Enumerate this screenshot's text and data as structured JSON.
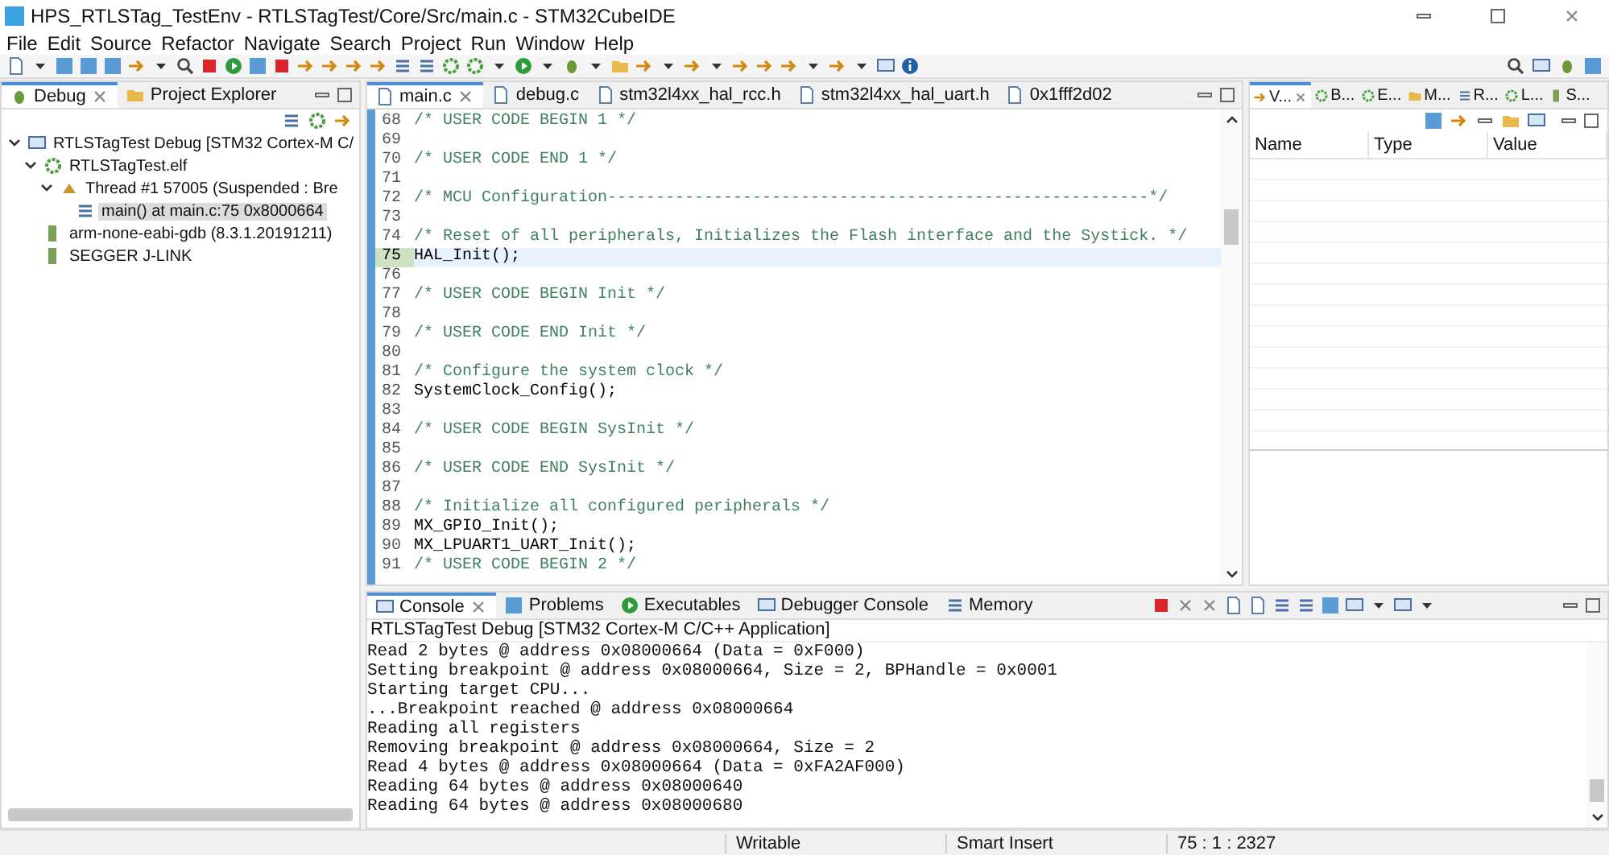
{
  "window": {
    "title": "HPS_RTLSTag_TestEnv - RTLSTagTest/Core/Src/main.c - STM32CubeIDE"
  },
  "menu": [
    "File",
    "Edit",
    "Source",
    "Refactor",
    "Navigate",
    "Search",
    "Project",
    "Run",
    "Window",
    "Help"
  ],
  "debug_panel": {
    "tabs": [
      {
        "label": "Debug",
        "selected": true
      },
      {
        "label": "Project Explorer",
        "selected": false
      }
    ],
    "tree": [
      {
        "label": "RTLSTagTest Debug [STM32 Cortex-M C/",
        "kind": "launch",
        "expanded": true,
        "selected": false,
        "children": [
          {
            "label": "RTLSTagTest.elf",
            "kind": "elf",
            "expanded": true,
            "selected": false,
            "children": [
              {
                "label": "Thread #1 57005 (Suspended : Bre",
                "kind": "thread",
                "expanded": true,
                "selected": false,
                "children": [
                  {
                    "label": "main() at main.c:75 0x8000664",
                    "kind": "frame",
                    "selected": true
                  }
                ]
              }
            ]
          },
          {
            "label": "arm-none-eabi-gdb (8.3.1.20191211)",
            "kind": "process",
            "selected": false
          },
          {
            "label": "SEGGER J-LINK",
            "kind": "process",
            "selected": false
          }
        ]
      }
    ]
  },
  "editor": {
    "tabs": [
      {
        "label": "main.c",
        "selected": true
      },
      {
        "label": "debug.c",
        "selected": false
      },
      {
        "label": "stm32l4xx_hal_rcc.h",
        "selected": false
      },
      {
        "label": "stm32l4xx_hal_uart.h",
        "selected": false
      },
      {
        "label": "0x1fff2d02",
        "selected": false
      }
    ],
    "lines": [
      {
        "number": "68",
        "text": "/* USER CODE BEGIN 1 */",
        "kind": "comment",
        "current": false
      },
      {
        "number": "69",
        "current": false
      },
      {
        "number": "70",
        "text": "/* USER CODE END 1 */",
        "kind": "comment",
        "current": false
      },
      {
        "number": "71",
        "current": false
      },
      {
        "number": "72",
        "text": "/* MCU Configuration--------------------------------------------------------*/",
        "kind": "comment",
        "current": false
      },
      {
        "number": "73",
        "current": false
      },
      {
        "number": "74",
        "text": "/* Reset of all peripherals, Initializes the Flash interface and the Systick. */",
        "kind": "comment",
        "current": false
      },
      {
        "number": "75",
        "text": "HAL_Init();",
        "kind": "code",
        "current": true
      },
      {
        "number": "76",
        "current": false
      },
      {
        "number": "77",
        "text": "/* USER CODE BEGIN Init */",
        "kind": "comment",
        "current": false
      },
      {
        "number": "78",
        "current": false
      },
      {
        "number": "79",
        "text": "/* USER CODE END Init */",
        "kind": "comment",
        "current": false
      },
      {
        "number": "80",
        "current": false
      },
      {
        "number": "81",
        "text": "/* Configure the system clock */",
        "kind": "comment",
        "current": false
      },
      {
        "number": "82",
        "text": "SystemClock_Config();",
        "kind": "code",
        "current": false
      },
      {
        "number": "83",
        "current": false
      },
      {
        "number": "84",
        "text": "/* USER CODE BEGIN SysInit */",
        "kind": "comment",
        "current": false
      },
      {
        "number": "85",
        "current": false
      },
      {
        "number": "86",
        "text": "/* USER CODE END SysInit */",
        "kind": "comment",
        "current": false
      },
      {
        "number": "87",
        "current": false
      },
      {
        "number": "88",
        "text": "/* Initialize all configured peripherals */",
        "kind": "comment",
        "current": false
      },
      {
        "number": "89",
        "text": "MX_GPIO_Init();",
        "kind": "code",
        "current": false
      },
      {
        "number": "90",
        "text": "MX_LPUART1_UART_Init();",
        "kind": "code",
        "current": false
      },
      {
        "number": "91",
        "text": "/* USER CODE BEGIN 2 */",
        "kind": "comment",
        "current": false
      }
    ]
  },
  "variables_panel": {
    "tabs": [
      {
        "label": "V...",
        "selected": true
      },
      {
        "label": "B...",
        "selected": false
      },
      {
        "label": "E...",
        "selected": false
      },
      {
        "label": "M...",
        "selected": false
      },
      {
        "label": "R...",
        "selected": false
      },
      {
        "label": "L...",
        "selected": false
      },
      {
        "label": "S...",
        "selected": false
      }
    ],
    "columns": [
      "Name",
      "Type",
      "Value"
    ]
  },
  "console": {
    "tabs": [
      {
        "label": "Console",
        "selected": true
      },
      {
        "label": "Problems",
        "selected": false
      },
      {
        "label": "Executables",
        "selected": false
      },
      {
        "label": "Debugger Console",
        "selected": false
      },
      {
        "label": "Memory",
        "selected": false
      }
    ],
    "header": "RTLSTagTest Debug [STM32 Cortex-M C/C++ Application]",
    "lines": [
      "Read 2 bytes @ address 0x08000664 (Data = 0xF000)",
      "Setting breakpoint @ address 0x08000664, Size = 2, BPHandle = 0x0001",
      "Starting target CPU...",
      "...Breakpoint reached @ address 0x08000664",
      "Reading all registers",
      "Removing breakpoint @ address 0x08000664, Size = 2",
      "Read 4 bytes @ address 0x08000664 (Data = 0xFA2AF000)",
      "Reading 64 bytes @ address 0x08000640",
      "Reading 64 bytes @ address 0x08000680"
    ]
  },
  "status_bar": [
    "Writable",
    "Smart Insert",
    "75 : 1 : 2327"
  ]
}
